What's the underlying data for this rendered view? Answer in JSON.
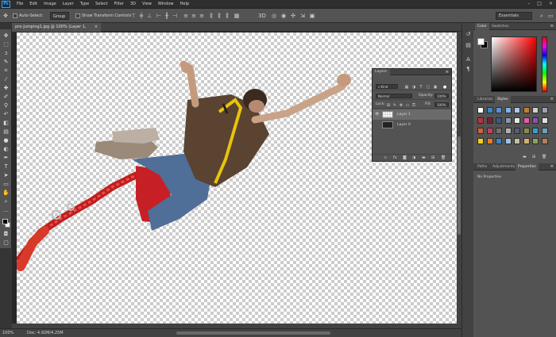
{
  "app": {
    "logo": "Ps"
  },
  "menu": [
    "File",
    "Edit",
    "Image",
    "Layer",
    "Type",
    "Select",
    "Filter",
    "3D",
    "View",
    "Window",
    "Help"
  ],
  "window_controls": [
    "–",
    "□",
    "×"
  ],
  "options_bar": {
    "auto_select_label": "Auto-Select:",
    "auto_select_target": "Group",
    "show_transform_label": "Show Transform Controls",
    "workspace": "Essentials"
  },
  "document": {
    "tab_title": "pre-Jumping1.jpg @ 100% (Layer 1, RGB/8) *",
    "close": "×"
  },
  "status": {
    "zoom": "100%",
    "doc_info": "Doc: 4.92M/4.25M"
  },
  "layers_panel": {
    "tab": "Layers",
    "menu": "≡",
    "filter_kind": "Kind",
    "blend_mode": "Normal",
    "opacity_label": "Opacity:",
    "opacity_value": "100%",
    "lock_label": "Lock:",
    "fill_label": "Fill:",
    "fill_value": "100%",
    "layers": [
      {
        "name": "Layer 1",
        "visible": true,
        "selected": true
      },
      {
        "name": "Layer 0",
        "visible": false,
        "selected": false
      }
    ]
  },
  "color_panel": {
    "tabs": [
      "Color",
      "Swatches"
    ],
    "active": "Color"
  },
  "styles_panel": {
    "tabs": [
      "Libraries",
      "Styles"
    ],
    "active": "Styles",
    "swatches": [
      "#ffffff",
      "#3a86c8",
      "#5a8fd0",
      "#7fb0e0",
      "#a8c8e8",
      "#c08030",
      "#d0d0d0",
      "#9aa4b0",
      "#c03040",
      "#7a2030",
      "#3d5a80",
      "#8898a8",
      "#e8e8e8",
      "#e060a0",
      "#9050b0",
      "#e0e0e0",
      "#d06040",
      "#c04060",
      "#707070",
      "#b0b0b0",
      "#506070",
      "#8a8a4a",
      "#30a0d0",
      "#6aa0c0",
      "#f0d020",
      "#e08020",
      "#4080c0",
      "#a0c0e0",
      "#c0c0a0",
      "#d0b070",
      "#90a060",
      "#b08060"
    ]
  },
  "properties_panel": {
    "tabs": [
      "Paths",
      "Adjustments",
      "Properties"
    ],
    "active": "Properties",
    "content": "No Properties"
  }
}
